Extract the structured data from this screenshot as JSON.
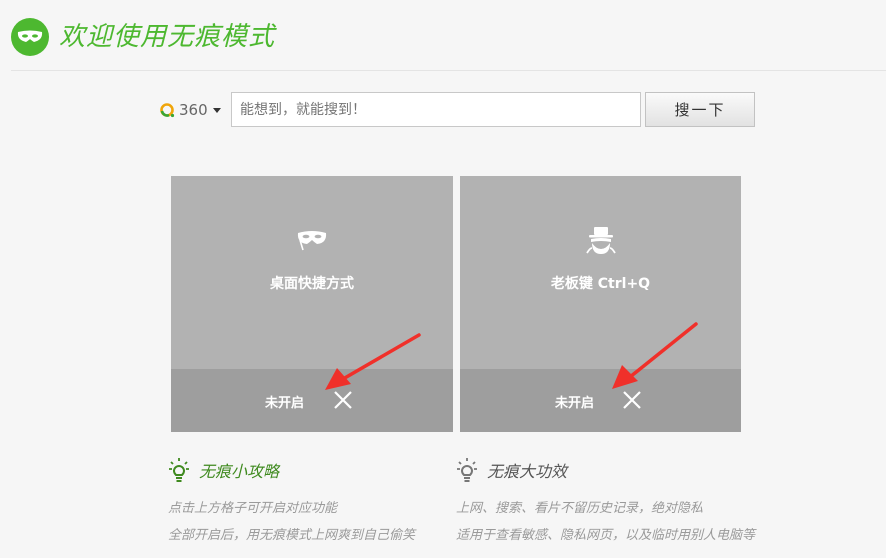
{
  "header": {
    "title": "欢迎使用无痕模式",
    "logo_icon": "mask-icon",
    "accent_color": "#4db830"
  },
  "search": {
    "engine_name": "360",
    "engine_icon": "360-search-logo-icon",
    "placeholder": "能想到，就能搜到！",
    "button_label": "搜一下"
  },
  "cards": [
    {
      "icon": "mask-icon",
      "title": "桌面快捷方式",
      "status": "未开启",
      "toggle_icon": "close-icon"
    },
    {
      "icon": "disguise-man-icon",
      "title": "老板键 Ctrl+Q",
      "status": "未开启",
      "toggle_icon": "close-icon"
    }
  ],
  "tips": [
    {
      "icon": "lightbulb-icon",
      "title": "无痕小攻略",
      "lines": [
        "点击上方格子可开启对应功能",
        "全部开启后，用无痕模式上网爽到自己偷笑"
      ]
    },
    {
      "icon": "lightbulb-icon",
      "title": "无痕大功效",
      "lines": [
        "上网、搜索、看片不留历史记录，绝对隐私",
        "适用于查看敏感、隐私网页，以及临时用别人电脑等"
      ]
    }
  ]
}
